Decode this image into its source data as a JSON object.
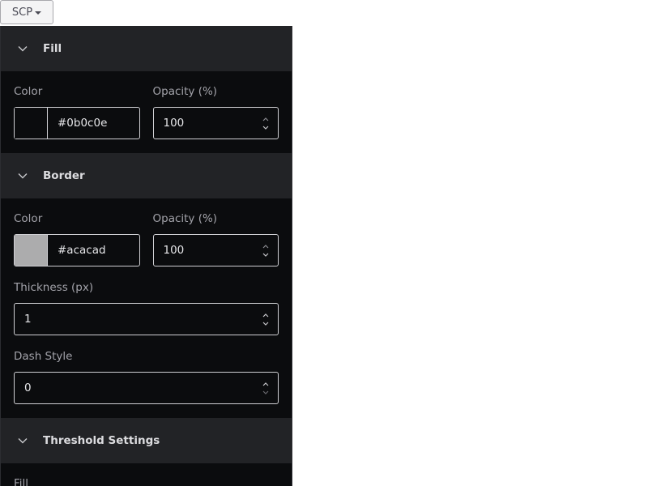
{
  "toolbar": {
    "scp_label": "SCP"
  },
  "sections": {
    "fill": {
      "title": "Fill",
      "color_label": "Color",
      "color_value": "#0b0c0e",
      "opacity_label": "Opacity (%)",
      "opacity_value": "100"
    },
    "border": {
      "title": "Border",
      "color_label": "Color",
      "color_value": "#acacad",
      "opacity_label": "Opacity (%)",
      "opacity_value": "100",
      "thickness_label": "Thickness (px)",
      "thickness_value": "1",
      "dash_label": "Dash Style",
      "dash_value": "0"
    },
    "threshold": {
      "title": "Threshold Settings",
      "fill_label": "Fill"
    }
  },
  "icons": {
    "section_toggle": "chevron-down-icon",
    "caret": "caret-down-icon",
    "spinner": "spinner-arrows-icon"
  }
}
